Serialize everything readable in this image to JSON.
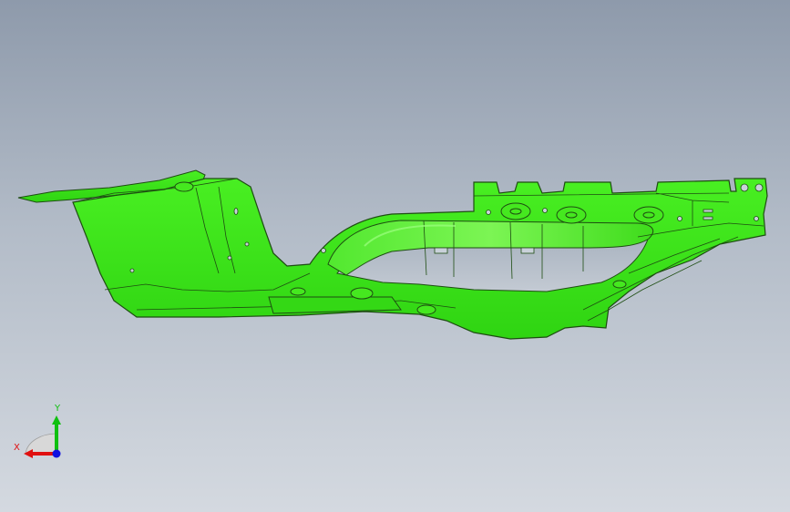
{
  "viewport": {
    "background_top": "#8e9aab",
    "background_bottom": "#d4d9e0",
    "part_color": "#3ee61a",
    "edge_color": "#1a3a10"
  },
  "triad": {
    "x_label": "X",
    "y_label": "Y",
    "x_color": "#e01010",
    "y_color": "#10c010",
    "z_color": "#1010e0"
  }
}
